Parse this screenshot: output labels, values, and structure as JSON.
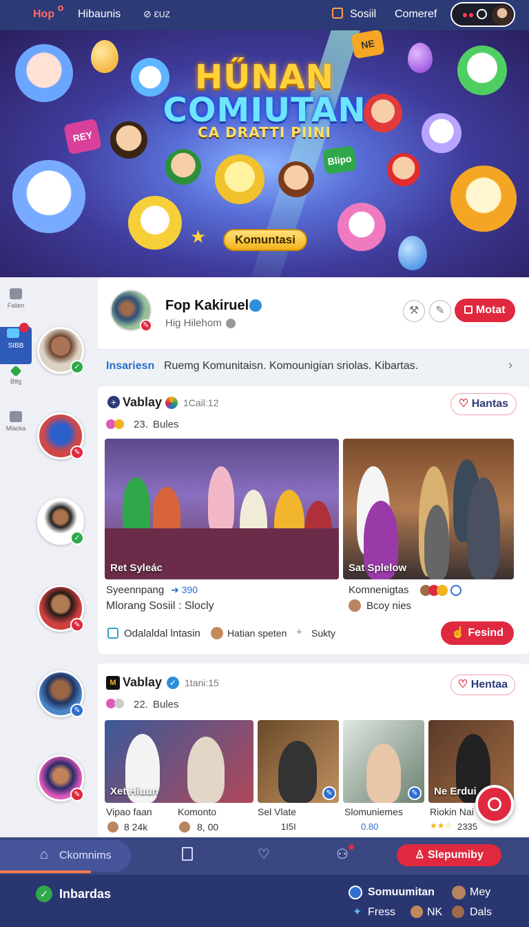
{
  "topbar": {
    "logo": "Hop",
    "nav1": "Hibaunis",
    "nav2": "ƐUZ",
    "nav3": "Sosiil",
    "nav4": "Comeref"
  },
  "hero": {
    "title1": "HŰNAN",
    "title2": "COMIUTAN",
    "subtitle": "CA DRATTI PIINI",
    "button": "Komuntasi",
    "bubble1": "NE",
    "bubble2": "REY",
    "bubble3": "Blipo"
  },
  "sidebar": {
    "items": [
      {
        "label": "Falien"
      },
      {
        "label": "SIBB"
      },
      {
        "label": "Bttg"
      },
      {
        "label": "Mlacka"
      }
    ]
  },
  "profile": {
    "name": "Fop Kakiruel",
    "subtitle": "Hig Hilehom",
    "button": "Motat",
    "info_label": "Insariesn",
    "info_text": "Ruemg Komunitaisn. Komounigian sriolas. Kibartas."
  },
  "post1": {
    "author": "Vablay",
    "time": "1Cail:12",
    "count": "23.",
    "count_label": "Bules",
    "follow": "Hantas",
    "photo1_caption": "Ret Syleác",
    "photo2_caption": "Sat Splelow",
    "left_line1": "Syeennpang",
    "left_stat": "390",
    "left_line2": "Mlorang  Sosiil : Slocly",
    "right_line1": "Komnenigtas",
    "right_line2": "Bcoy  nies",
    "action1": "Odalaldal lntasin",
    "action2": "Hatian speten",
    "action3": "Sukty",
    "action_button": "Fesind"
  },
  "post2": {
    "author": "Vablay",
    "time": "1tani:15",
    "count": "22.",
    "count_label": "Bules",
    "follow": "Hentaa",
    "photos": [
      {
        "caption": "Xet Hiuun",
        "label1": "Vipao faan",
        "label2": "Komonto",
        "stat1": "8 24k",
        "stat2": "8, 00"
      },
      {
        "caption": "",
        "label1": "Sel Vlate",
        "label2": "",
        "stat1": "1I5I",
        "stat2": ""
      },
      {
        "caption": "",
        "label1": "Slomuniemes",
        "label2": "",
        "stat1": "0.80",
        "stat2": ""
      },
      {
        "caption": "Ne Erdui",
        "label1": "Riokin Nai",
        "label2": "",
        "stat1": "2335",
        "stat2": ""
      }
    ]
  },
  "bottomnav": {
    "home": "Ckomnims",
    "cta": "Slepumiby"
  },
  "footer": {
    "left": "Inbardas",
    "r1": "Somuumitan",
    "r2": "Mey",
    "r3": "Fress",
    "r4": "NK",
    "r5": "Dals"
  },
  "colors": {
    "primary": "#2c3a76",
    "accent_red": "#e0283f",
    "link_blue": "#2a6fc9"
  }
}
